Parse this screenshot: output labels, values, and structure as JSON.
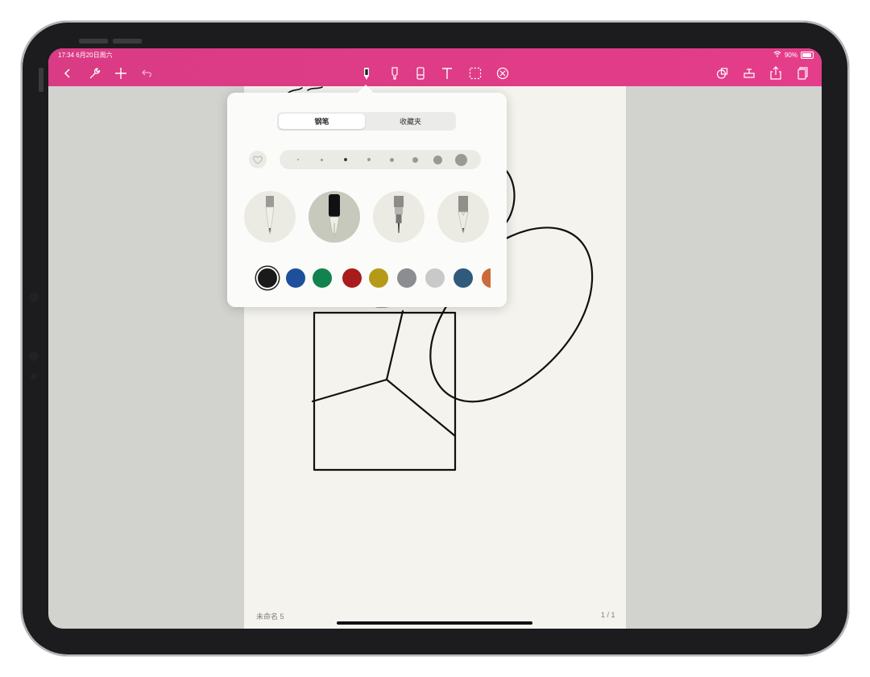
{
  "status_bar": {
    "time_date": "17:34  6月20日周六",
    "battery": "90%",
    "battery_level": 0.9,
    "icons": [
      "wifi-icon",
      "battery-icon"
    ]
  },
  "toolbar": {
    "left_icons": [
      "back-chevron-icon",
      "wrench-icon",
      "plus-icon",
      "undo-icon"
    ],
    "center_icons": [
      "pen-tool-icon",
      "highlighter-icon",
      "eraser-icon",
      "text-tool-icon",
      "lasso-select-icon",
      "disable-touch-icon"
    ],
    "right_icons": [
      "shapes-icon",
      "stamp-icon",
      "share-icon",
      "pages-icon"
    ],
    "active_tool": "pen-tool-icon",
    "accent_color": "#df3b87"
  },
  "popover": {
    "tabs": [
      "钢笔",
      "收藏夹"
    ],
    "selected_tab": "钢笔",
    "favorite_icon": "heart-icon",
    "sizes_count": 8,
    "selected_size": 3,
    "pens": [
      "pencil-pen-icon",
      "fountain-pen-icon",
      "technical-pen-icon",
      "brush-pen-icon"
    ],
    "selected_pen": 2,
    "colors": [
      "#1a1a1a",
      "#1d4f9c",
      "#12834e",
      "#a81c1c",
      "#b59a17",
      "#8c8d91",
      "#c9c9c9",
      "#2f5a7c",
      "#cc6a3a"
    ],
    "selected_color": "#1a1a1a"
  },
  "document": {
    "name": "未命名 5",
    "page_indicator": "1 / 1"
  }
}
